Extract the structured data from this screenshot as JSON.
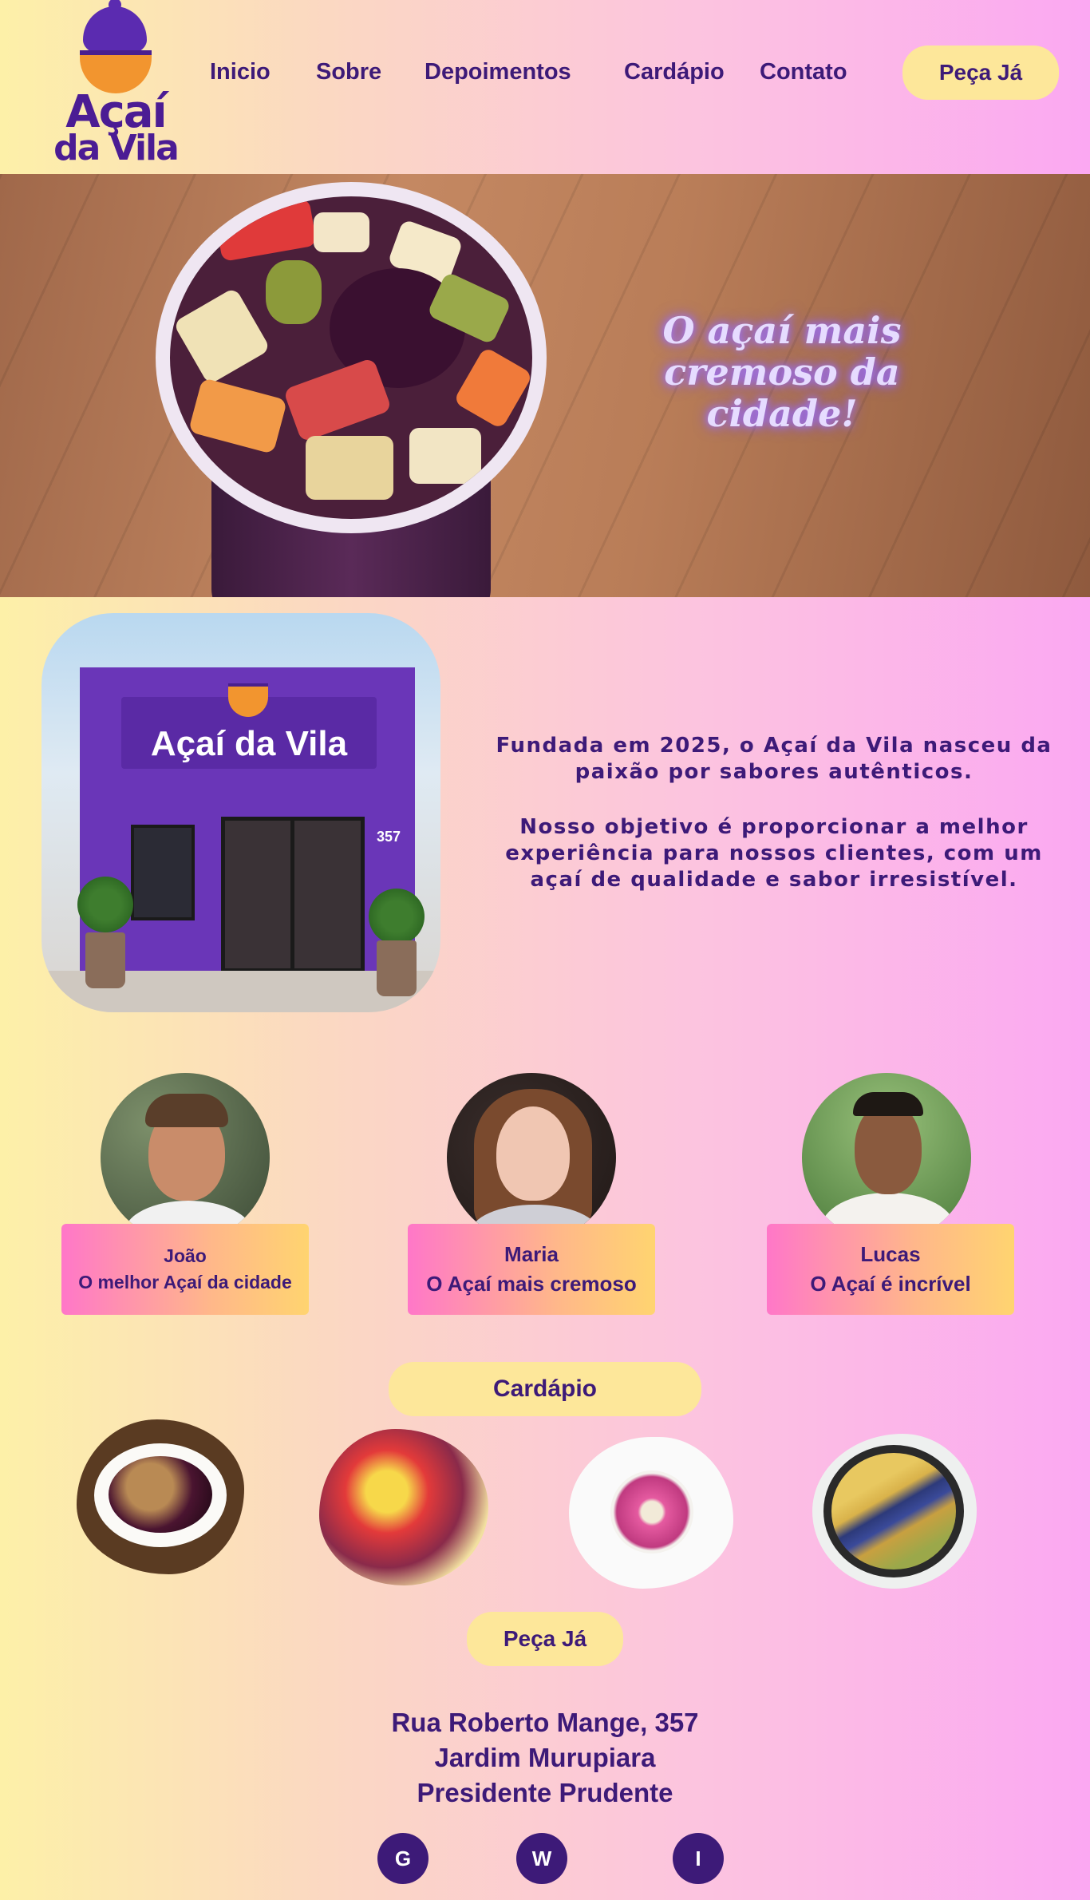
{
  "header": {
    "logo": {
      "line1": "Açaí",
      "line2": "da Vila"
    },
    "nav": [
      "Inicio",
      "Sobre",
      "Depoimentos",
      "Cardápio",
      "Contato"
    ],
    "cta": "Peça Já"
  },
  "hero": {
    "tagline_line1": "O açaí mais",
    "tagline_line2": "cremoso da cidade!"
  },
  "about": {
    "storefront_sign": "Açaí da Vila",
    "storefront_number": "357",
    "paragraph1": "Fundada em 2025, o Açaí da Vila nasceu da paixão por sabores autênticos.",
    "paragraph2": "Nosso objetivo é proporcionar a melhor experiência para nossos clientes, com um açaí de qualidade e sabor irresistível."
  },
  "testimonials": [
    {
      "name": "João",
      "quote": "O melhor Açaí da cidade"
    },
    {
      "name": "Maria",
      "quote": "O Açaí mais cremoso"
    },
    {
      "name": "Lucas",
      "quote": "O Açaí é incrível"
    }
  ],
  "menu": {
    "title": "Cardápio",
    "cta": "Peça Já"
  },
  "footer": {
    "address_line1": "Rua Roberto Mange, 357",
    "address_line2": "Jardim Murupiara",
    "address_line3": "Presidente Prudente",
    "social": [
      "G",
      "W",
      "I"
    ]
  },
  "colors": {
    "primary_purple": "#3d1a78",
    "button_yellow": "#fde79a",
    "card_gradient_start": "#ff77c8",
    "card_gradient_end": "#ffd470"
  }
}
